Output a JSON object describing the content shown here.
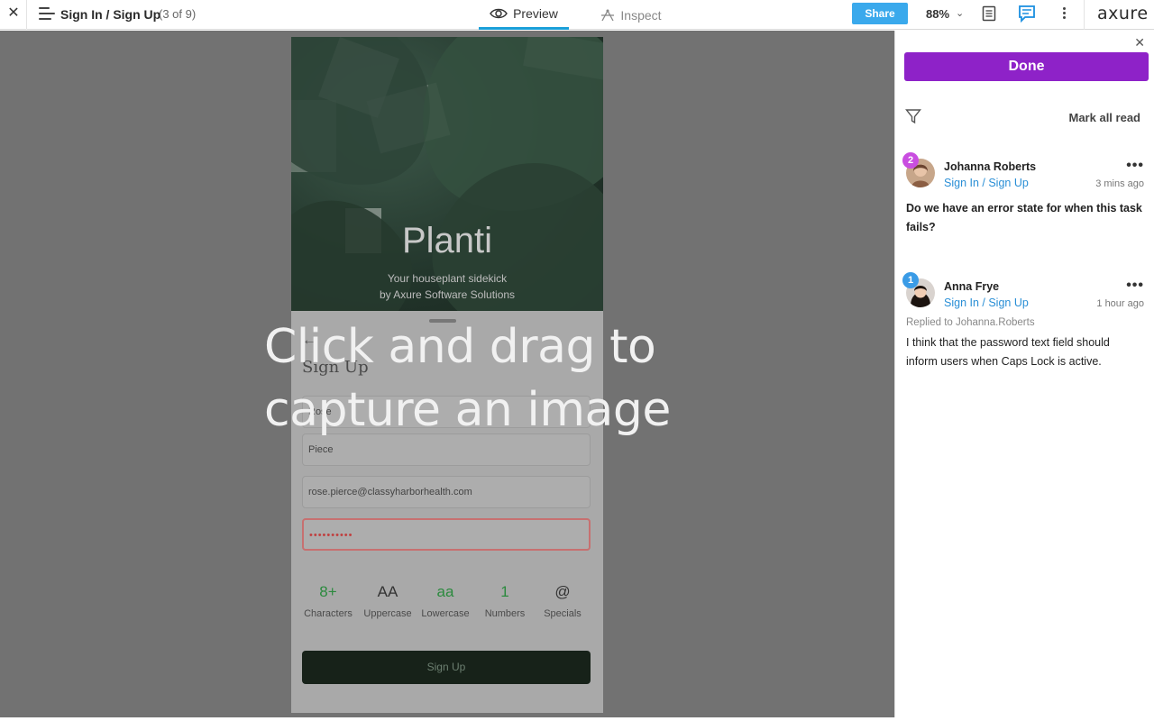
{
  "topbar": {
    "close": "✕",
    "page_title": "Sign In / Sign Up",
    "page_count": "(3 of 9)",
    "tabs": [
      {
        "label": "Preview",
        "active": true
      },
      {
        "label": "Inspect",
        "active": false
      }
    ],
    "share_label": "Share",
    "zoom": "88%",
    "zoom_chevron": "⌄",
    "logo": "axure"
  },
  "canvas": {
    "overlay_text_line1": "Click and drag to",
    "overlay_text_line2": "capture an image",
    "prototype": {
      "hero_title": "Planti",
      "hero_subtitle_line1": "Your houseplant sidekick",
      "hero_subtitle_line2": "by Axure Software Solutions",
      "back_arrow": "←",
      "form_title": "Sign Up",
      "fields": [
        {
          "value": "Rose"
        },
        {
          "value": "Piece"
        },
        {
          "value": "rose.pierce@classyharborhealth.com"
        },
        {
          "value": "••••••••••"
        }
      ],
      "requirements": [
        {
          "symbol": "8+",
          "label": "Characters",
          "met": true
        },
        {
          "symbol": "AA",
          "label": "Uppercase",
          "met": false
        },
        {
          "symbol": "aa",
          "label": "Lowercase",
          "met": true
        },
        {
          "symbol": "1",
          "label": "Numbers",
          "met": true
        },
        {
          "symbol": "@",
          "label": "Specials",
          "met": false
        }
      ],
      "signup_label": "Sign Up"
    }
  },
  "panel": {
    "close": "✕",
    "done_label": "Done",
    "mark_all_read": "Mark all read",
    "comments": [
      {
        "badge": "2",
        "badge_color": "#c94ee0",
        "author": "Johanna Roberts",
        "page": "Sign In / Sign Up",
        "time": "3 mins ago",
        "replied_to": "",
        "body": "Do we have an error state for when this task fails?",
        "more": "•••"
      },
      {
        "badge": "1",
        "badge_color": "#3a9be6",
        "author": "Anna Frye",
        "page": "Sign In / Sign Up",
        "time": "1 hour ago",
        "replied_to": "Replied to Johanna.Roberts",
        "body": "I think that the password text field should inform users when Caps Lock is active.",
        "more": "•••"
      }
    ]
  },
  "colors": {
    "accent_blue": "#1a9fd8",
    "share_blue": "#3aa9ec",
    "done_purple": "#8e22c8",
    "link_blue": "#2a8fd6"
  }
}
